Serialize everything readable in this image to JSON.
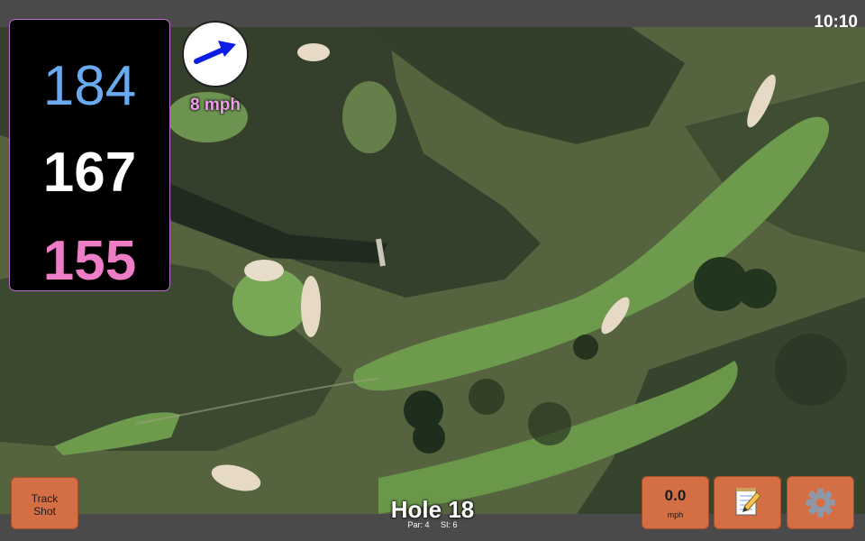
{
  "status": {
    "time": "10:10"
  },
  "yardages": {
    "back": "184",
    "middle": "167",
    "front": "155"
  },
  "wind": {
    "speed_label": "8 mph",
    "direction": "east-northeast"
  },
  "hole": {
    "title": "Hole 18",
    "par": "Par: 4",
    "si": "SI: 6"
  },
  "buttons": {
    "track_line1": "Track",
    "track_line2": "Shot",
    "speed_value": "0.0",
    "speed_unit": "mph",
    "notes_icon": "notepad-pencil-icon",
    "settings_icon": "gear-icon"
  },
  "colors": {
    "back": "#6aaaf0",
    "middle": "#ffffff",
    "front": "#ee7dc7",
    "button": "#d36e45",
    "wind_text": "#ec9fe6",
    "wind_arrow": "#0a1ee6"
  }
}
